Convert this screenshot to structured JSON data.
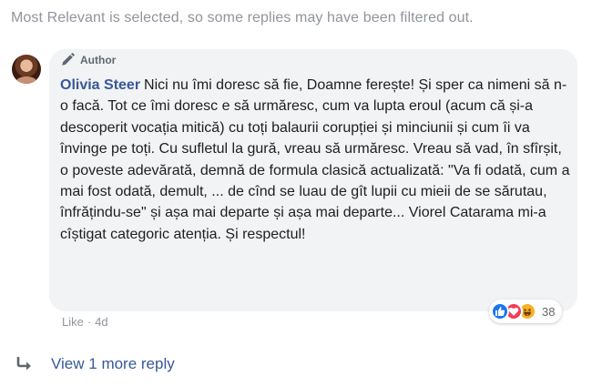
{
  "filter_note": "Most Relevant is selected, so some replies may have been filtered out.",
  "comment": {
    "author_badge": "Author",
    "author_name": "Olivia Steer",
    "text": "Nici nu îmi doresc să fie, Doamne ferește! Și sper ca nimeni să n-o facă. Tot ce îmi doresc e să urmăresc, cum va lupta eroul (acum că și-a descoperit vocația mitică) cu toți balaurii corupției și minciunii și cum îi va învinge pe toți. Cu sufletul la gură, vreau să urmăresc. Vreau să vad, în sfîrșit, o poveste adevărată, demnă de formula clasică actualizată: \"Va fi odată, cum a mai fost odată, demult, ... de cînd se luau de gît lupii cu mieii de se sărutau, înfrățindu-se\" și așa mai departe și așa mai departe... Viorel Catarama mi-a cîștigat categoric atenția. Și respectul!",
    "reactions": {
      "icons": [
        "like-icon",
        "love-icon",
        "haha-icon"
      ],
      "count": "38"
    },
    "like_label": "Like",
    "separator": "·",
    "timestamp": "4d"
  },
  "view_more": "View 1 more reply",
  "colors": {
    "link": "#385898",
    "bubble": "#f2f3f5",
    "muted": "#90949c"
  }
}
